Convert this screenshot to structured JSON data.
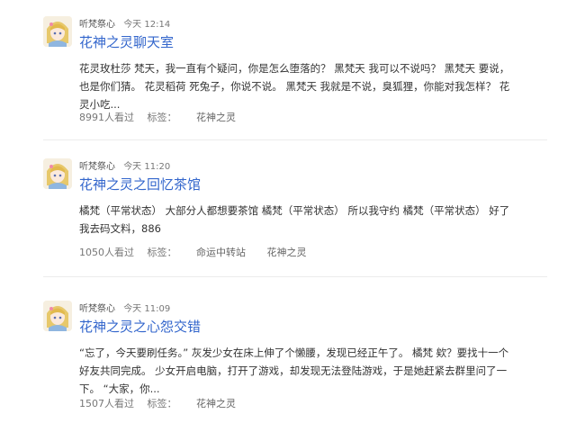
{
  "posts": [
    {
      "author": "听梵祭心",
      "time": "今天 12:14",
      "title": "花神之灵聊天室",
      "excerpt": "花灵玫杜莎 梵天，我一直有个疑问，你是怎么堕落的？ 黑梵天 我可以不说吗？ 黑梵天 要说，也是你们猜。 花灵稻荷 死兔子，你说不说。 黑梵天 我就是不说，臭狐狸，你能对我怎样？ 花灵小吃...",
      "views": "8991人看过",
      "tag_label": "标签：",
      "tags": [
        "花神之灵"
      ]
    },
    {
      "author": "听梵祭心",
      "time": "今天 11:20",
      "title": "花神之灵之回忆茶馆",
      "excerpt": "橘梵（平常状态） 大部分人都想要茶馆 橘梵（平常状态） 所以我守约 橘梵（平常状态） 好了我去码文料，886",
      "views": "1050人看过",
      "tag_label": "标签：",
      "tags": [
        "命运中转站",
        "花神之灵"
      ]
    },
    {
      "author": "听梵祭心",
      "time": "今天 11:09",
      "title": "花神之灵之心怨交错",
      "excerpt": "“忘了，今天要刷任务。” 灰发少女在床上伸了个懒腰，发现已经正午了。 橘梵 欸？要找十一个好友共同完成。 少女开启电脑，打开了游戏，却发现无法登陆游戏，于是她赶紧去群里问了一下。 “大家，你...",
      "views": "1507人看过",
      "tag_label": "标签：",
      "tags": [
        "花神之灵"
      ]
    }
  ]
}
